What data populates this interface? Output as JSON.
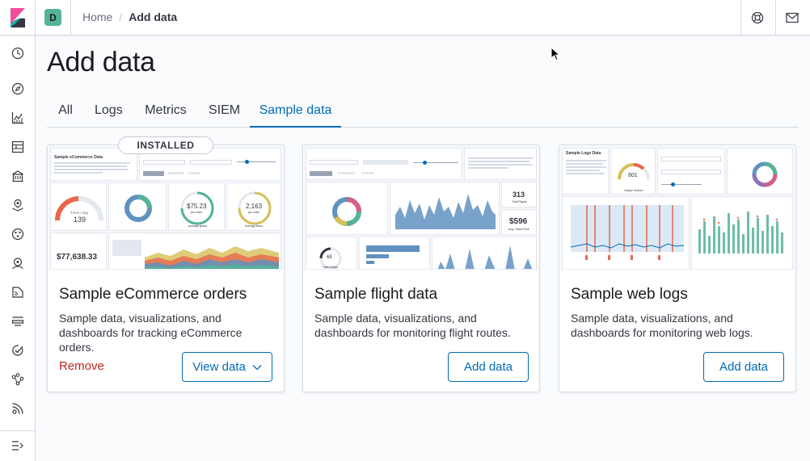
{
  "header": {
    "space_initial": "D",
    "breadcrumbs": [
      "Home",
      "Add data"
    ],
    "help_icon": "help-lifebuoy-icon",
    "mail_icon": "mail-icon"
  },
  "sidenav": {
    "items": [
      "clock-icon",
      "compass-icon",
      "visualize-icon",
      "dashboard-icon",
      "canvas-icon",
      "maps-icon",
      "ml-icon",
      "infrastructure-icon",
      "logs-icon",
      "apm-icon",
      "uptime-icon",
      "graph-icon",
      "monitoring-icon"
    ],
    "collapse_icon": "collapse-menu-icon"
  },
  "page": {
    "title": "Add data",
    "tabs": [
      "All",
      "Logs",
      "Metrics",
      "SIEM",
      "Sample data"
    ],
    "selected_tab": "Sample data"
  },
  "cards": [
    {
      "title": "Sample eCommerce orders",
      "description": "Sample data, visualizations, and dashboards for tracking eCommerce orders.",
      "badge": "INSTALLED",
      "remove_label": "Remove",
      "action_label": "View data",
      "preview": {
        "heading": "Sample eCommerce Data",
        "gauge_value": "139",
        "gauge_label": "Trxns / day",
        "metric_1": "$75.23",
        "metric_1_sub": "per order",
        "metric_1_caption": "average spend",
        "metric_2": "2,163",
        "metric_2_sub": "per order",
        "metric_2_caption": "average items",
        "revenue": "$77,638.33"
      }
    },
    {
      "title": "Sample flight data",
      "description": "Sample data, visualizations, and dashboards for monitoring flight routes.",
      "action_label": "Add data",
      "preview": {
        "total_flights": "313",
        "total_flights_label": "Total Flights",
        "avg_price": "$596",
        "avg_price_label": "Avg. Ticket Price",
        "total_delays": "68",
        "total_delays_label": "Total Delays"
      }
    },
    {
      "title": "Sample web logs",
      "description": "Sample data, visualizations, and dashboards for monitoring web logs.",
      "action_label": "Add data",
      "preview": {
        "heading": "Sample Logs Data",
        "unique_visitors": "801",
        "unique_visitors_label": "Unique Visitors"
      }
    }
  ],
  "colors": {
    "primary": "#006bb4",
    "danger": "#bd271e",
    "space_badge": "#54b399"
  }
}
